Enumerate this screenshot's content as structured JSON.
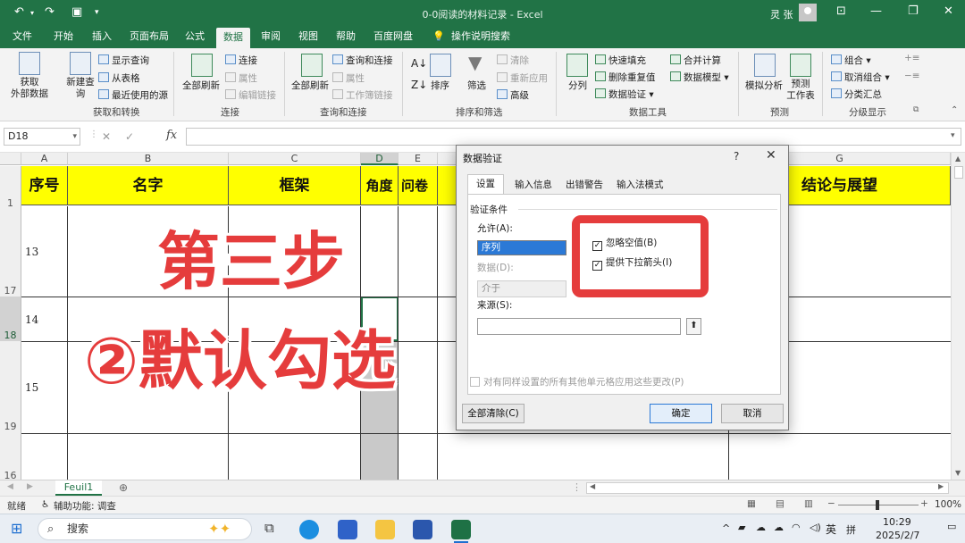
{
  "window": {
    "title": "0-0阅读的材料记录 - Excel",
    "user": "灵 张"
  },
  "ribbon": {
    "tabs": [
      "文件",
      "开始",
      "插入",
      "页面布局",
      "公式",
      "数据",
      "审阅",
      "视图",
      "帮助",
      "百度网盘",
      "操作说明搜索"
    ],
    "active_tab": "数据",
    "groups": {
      "get_transform": {
        "label": "获取和转换",
        "get_data": "获取\n外部数据",
        "new_query": "新建查\n询",
        "show_queries": "显示查询",
        "from_table": "从表格",
        "recent_sources": "最近使用的源"
      },
      "connections": {
        "label": "连接",
        "refresh_all": "全部刷新",
        "connections": "连接",
        "properties": "属性",
        "edit_links": "编辑链接"
      },
      "queries_connections": {
        "label": "查询和连接",
        "refresh_all": "全部刷新",
        "queries_conn": "查询和连接",
        "properties": "属性",
        "workbook_links": "工作簿链接"
      },
      "sort_filter": {
        "label": "排序和筛选",
        "sort": "排序",
        "filter": "筛选",
        "clear": "清除",
        "reapply": "重新应用",
        "advanced": "高级"
      },
      "data_tools": {
        "label": "数据工具",
        "text_to_columns": "分列",
        "flash_fill": "快速填充",
        "remove_duplicates": "删除重复值",
        "data_validation": "数据验证",
        "consolidate": "合并计算",
        "data_model": "数据模型"
      },
      "forecast": {
        "label": "预测",
        "what_if": "模拟分析",
        "forecast_sheet": "预测\n工作表"
      },
      "outline": {
        "label": "分级显示",
        "group": "组合",
        "ungroup": "取消组合",
        "subtotal": "分类汇总"
      }
    }
  },
  "formula_bar": {
    "name_box": "D18",
    "fx": "fx"
  },
  "sheet": {
    "columns": [
      "A",
      "B",
      "C",
      "D",
      "E",
      "G"
    ],
    "selected_column": "D",
    "headers": [
      "序号",
      "名字",
      "框架",
      "角度",
      "问卷",
      "结论与展望"
    ],
    "row_numbers": [
      "1",
      "17",
      "18",
      "19",
      "16"
    ],
    "row_values": [
      "13",
      "14",
      "15"
    ]
  },
  "overlay": {
    "line1": "第三步",
    "line2": "②默认勾选"
  },
  "dialog": {
    "title": "数据验证",
    "help": "?",
    "close": "✕",
    "tabs": [
      "设置",
      "输入信息",
      "出错警告",
      "输入法模式"
    ],
    "active_tab": "设置",
    "section": "验证条件",
    "allow_label": "允许(A):",
    "allow_value": "序列",
    "data_label": "数据(D):",
    "data_value": "介于",
    "ignore_blank": "忽略空值(B)",
    "ignore_blank_checked": true,
    "dropdown": "提供下拉箭头(I)",
    "dropdown_checked": true,
    "source_label": "来源(S):",
    "source_value": "",
    "apply_all": "对有同样设置的所有其他单元格应用这些更改(P)",
    "clear_all": "全部清除(C)",
    "ok": "确定",
    "cancel": "取消"
  },
  "sheet_tab": "Feuil1",
  "status": {
    "ready": "就绪",
    "accessibility": "辅助功能: 调查",
    "zoom": "100%"
  },
  "taskbar": {
    "search": "搜索",
    "lang": "英",
    "ime": "拼",
    "time": "10:29",
    "date": "2025/2/7"
  },
  "colors": {
    "excel_green": "#217346",
    "header_yellow": "#ffff00",
    "overlay_red": "#e53c3c"
  }
}
